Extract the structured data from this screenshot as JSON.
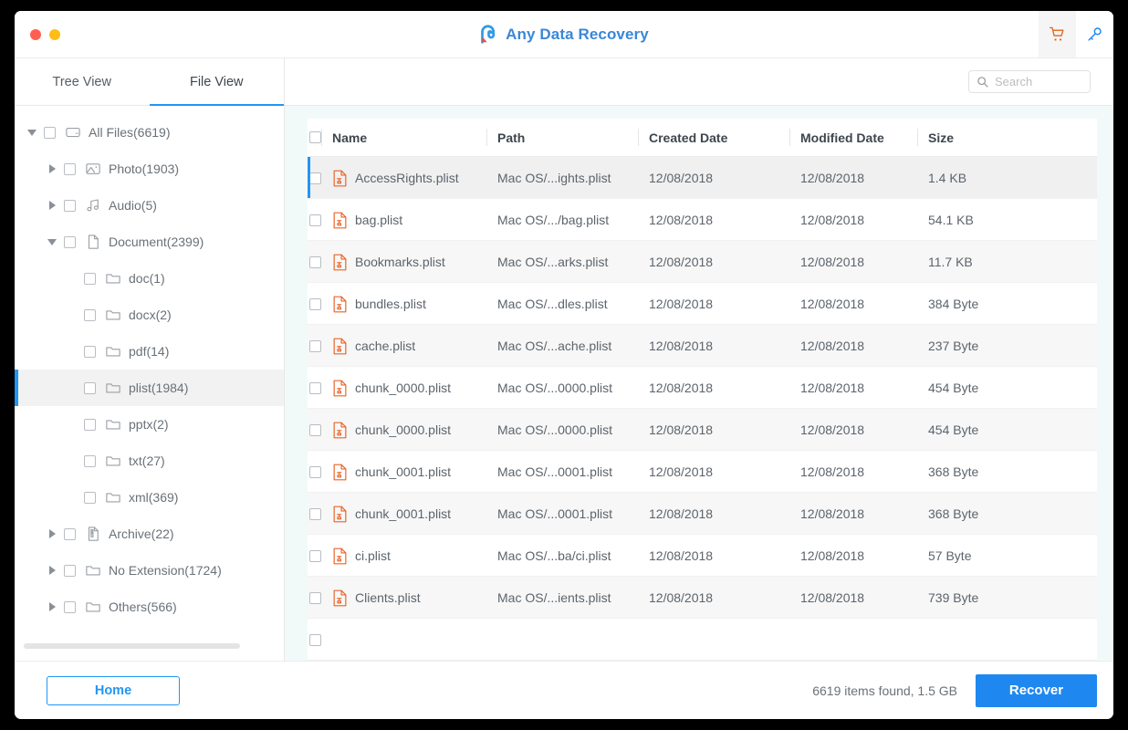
{
  "window": {
    "title": "Any Data Recovery",
    "traffic_lights": [
      "close",
      "minimize"
    ]
  },
  "titlebar": {
    "cart_icon": "shopping-cart-icon",
    "key_icon": "key-icon",
    "logo_icon": "app-logo-icon"
  },
  "tabs": [
    {
      "label": "Tree View",
      "active": false
    },
    {
      "label": "File View",
      "active": true
    }
  ],
  "search": {
    "placeholder": "Search",
    "value": "",
    "icon": "search-icon"
  },
  "tree": [
    {
      "label": "All Files(6619)",
      "depth": 0,
      "caret": "down",
      "icon": "drive-icon",
      "selected": false
    },
    {
      "label": "Photo(1903)",
      "depth": 1,
      "caret": "right",
      "icon": "photo-icon",
      "selected": false
    },
    {
      "label": "Audio(5)",
      "depth": 1,
      "caret": "right",
      "icon": "audio-icon",
      "selected": false
    },
    {
      "label": "Document(2399)",
      "depth": 1,
      "caret": "down",
      "icon": "document-icon",
      "selected": false
    },
    {
      "label": "doc(1)",
      "depth": 2,
      "caret": "none",
      "icon": "folder-icon",
      "selected": false
    },
    {
      "label": "docx(2)",
      "depth": 2,
      "caret": "none",
      "icon": "folder-icon",
      "selected": false
    },
    {
      "label": "pdf(14)",
      "depth": 2,
      "caret": "none",
      "icon": "folder-icon",
      "selected": false
    },
    {
      "label": "plist(1984)",
      "depth": 2,
      "caret": "none",
      "icon": "folder-icon",
      "selected": true
    },
    {
      "label": "pptx(2)",
      "depth": 2,
      "caret": "none",
      "icon": "folder-icon",
      "selected": false
    },
    {
      "label": "txt(27)",
      "depth": 2,
      "caret": "none",
      "icon": "folder-icon",
      "selected": false
    },
    {
      "label": "xml(369)",
      "depth": 2,
      "caret": "none",
      "icon": "folder-icon",
      "selected": false
    },
    {
      "label": "Archive(22)",
      "depth": 1,
      "caret": "right",
      "icon": "archive-icon",
      "selected": false
    },
    {
      "label": "No Extension(1724)",
      "depth": 1,
      "caret": "right",
      "icon": "folder-icon",
      "selected": false
    },
    {
      "label": "Others(566)",
      "depth": 1,
      "caret": "right",
      "icon": "folder-icon",
      "selected": false
    }
  ],
  "table": {
    "columns": [
      "Name",
      "Path",
      "Created Date",
      "Modified Date",
      "Size"
    ],
    "rows": [
      {
        "name": "AccessRights.plist",
        "path": "Mac OS/...ights.plist",
        "created": "12/08/2018",
        "modified": "12/08/2018",
        "size": "1.4 KB",
        "selected": true
      },
      {
        "name": "bag.plist",
        "path": "Mac OS/.../bag.plist",
        "created": "12/08/2018",
        "modified": "12/08/2018",
        "size": "54.1 KB",
        "selected": false
      },
      {
        "name": "Bookmarks.plist",
        "path": "Mac OS/...arks.plist",
        "created": "12/08/2018",
        "modified": "12/08/2018",
        "size": "11.7 KB",
        "selected": false
      },
      {
        "name": "bundles.plist",
        "path": "Mac OS/...dles.plist",
        "created": "12/08/2018",
        "modified": "12/08/2018",
        "size": "384 Byte",
        "selected": false
      },
      {
        "name": "cache.plist",
        "path": "Mac OS/...ache.plist",
        "created": "12/08/2018",
        "modified": "12/08/2018",
        "size": "237 Byte",
        "selected": false
      },
      {
        "name": "chunk_0000.plist",
        "path": "Mac OS/...0000.plist",
        "created": "12/08/2018",
        "modified": "12/08/2018",
        "size": "454 Byte",
        "selected": false
      },
      {
        "name": "chunk_0000.plist",
        "path": "Mac OS/...0000.plist",
        "created": "12/08/2018",
        "modified": "12/08/2018",
        "size": "454 Byte",
        "selected": false
      },
      {
        "name": "chunk_0001.plist",
        "path": "Mac OS/...0001.plist",
        "created": "12/08/2018",
        "modified": "12/08/2018",
        "size": "368 Byte",
        "selected": false
      },
      {
        "name": "chunk_0001.plist",
        "path": "Mac OS/...0001.plist",
        "created": "12/08/2018",
        "modified": "12/08/2018",
        "size": "368 Byte",
        "selected": false
      },
      {
        "name": "ci.plist",
        "path": "Mac OS/...ba/ci.plist",
        "created": "12/08/2018",
        "modified": "12/08/2018",
        "size": "57 Byte",
        "selected": false
      },
      {
        "name": "Clients.plist",
        "path": "Mac OS/...ients.plist",
        "created": "12/08/2018",
        "modified": "12/08/2018",
        "size": "739 Byte",
        "selected": false
      },
      {
        "name": "",
        "path": "",
        "created": "",
        "modified": "",
        "size": "",
        "selected": false
      }
    ]
  },
  "footer": {
    "home_label": "Home",
    "status": "6619 items found, 1.5 GB",
    "recover_label": "Recover"
  },
  "colors": {
    "accent_blue": "#2196f3",
    "recover_blue": "#1e88f0",
    "file_orange": "#e8652a",
    "cart_orange": "#e2631f",
    "title_blue": "#3b87d6"
  }
}
